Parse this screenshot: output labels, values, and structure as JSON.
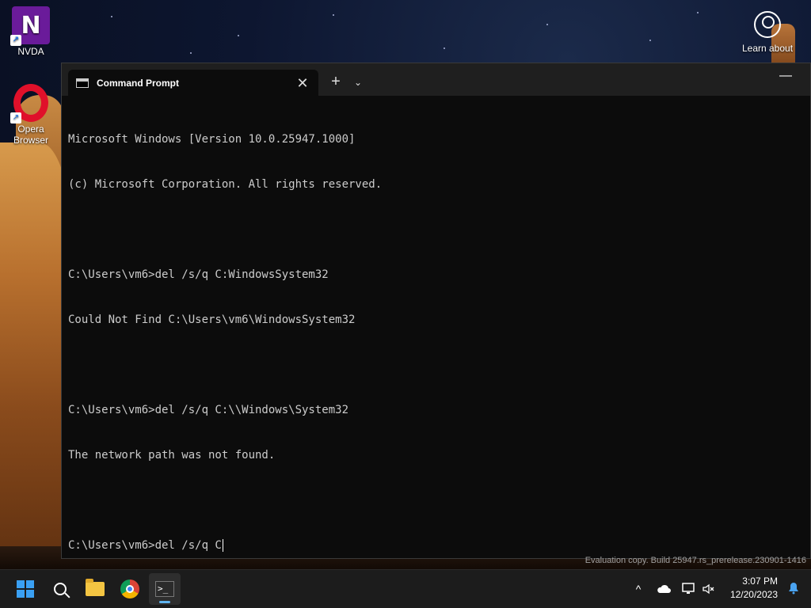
{
  "desktop": {
    "icons": [
      {
        "label": "NVDA",
        "glyph": "N"
      },
      {
        "label": "Opera Browser"
      }
    ],
    "learn_about": "Learn about"
  },
  "terminal": {
    "tab_title": "Command Prompt",
    "new_tab_glyph": "+",
    "dropdown_glyph": "⌄",
    "close_glyph": "✕",
    "minimize_glyph": "—",
    "lines": [
      "Microsoft Windows [Version 10.0.25947.1000]",
      "(c) Microsoft Corporation. All rights reserved.",
      "",
      "C:\\Users\\vm6>del /s/q C:WindowsSystem32",
      "Could Not Find C:\\Users\\vm6\\WindowsSystem32",
      "",
      "C:\\Users\\vm6>del /s/q C:\\\\Windows\\System32",
      "The network path was not found.",
      "",
      "C:\\Users\\vm6>del /s/q C"
    ]
  },
  "watermark": "Evaluation copy. Build 25947.rs_prerelease.230901-1416",
  "taskbar": {
    "time": "3:07 PM",
    "date": "12/20/2023",
    "tray_chevron": "^"
  },
  "icons": {
    "start": "windows-logo-icon",
    "search": "search-icon",
    "explorer": "folder-icon",
    "chrome": "chrome-icon",
    "terminal": "terminal-icon",
    "onedrive": "cloud-icon",
    "network": "network-icon",
    "volume": "volume-muted-icon",
    "notifications": "bell-icon"
  },
  "colors": {
    "terminal_bg": "#0c0c0c",
    "terminal_text": "#cccccc",
    "accent": "#60b4f0"
  }
}
